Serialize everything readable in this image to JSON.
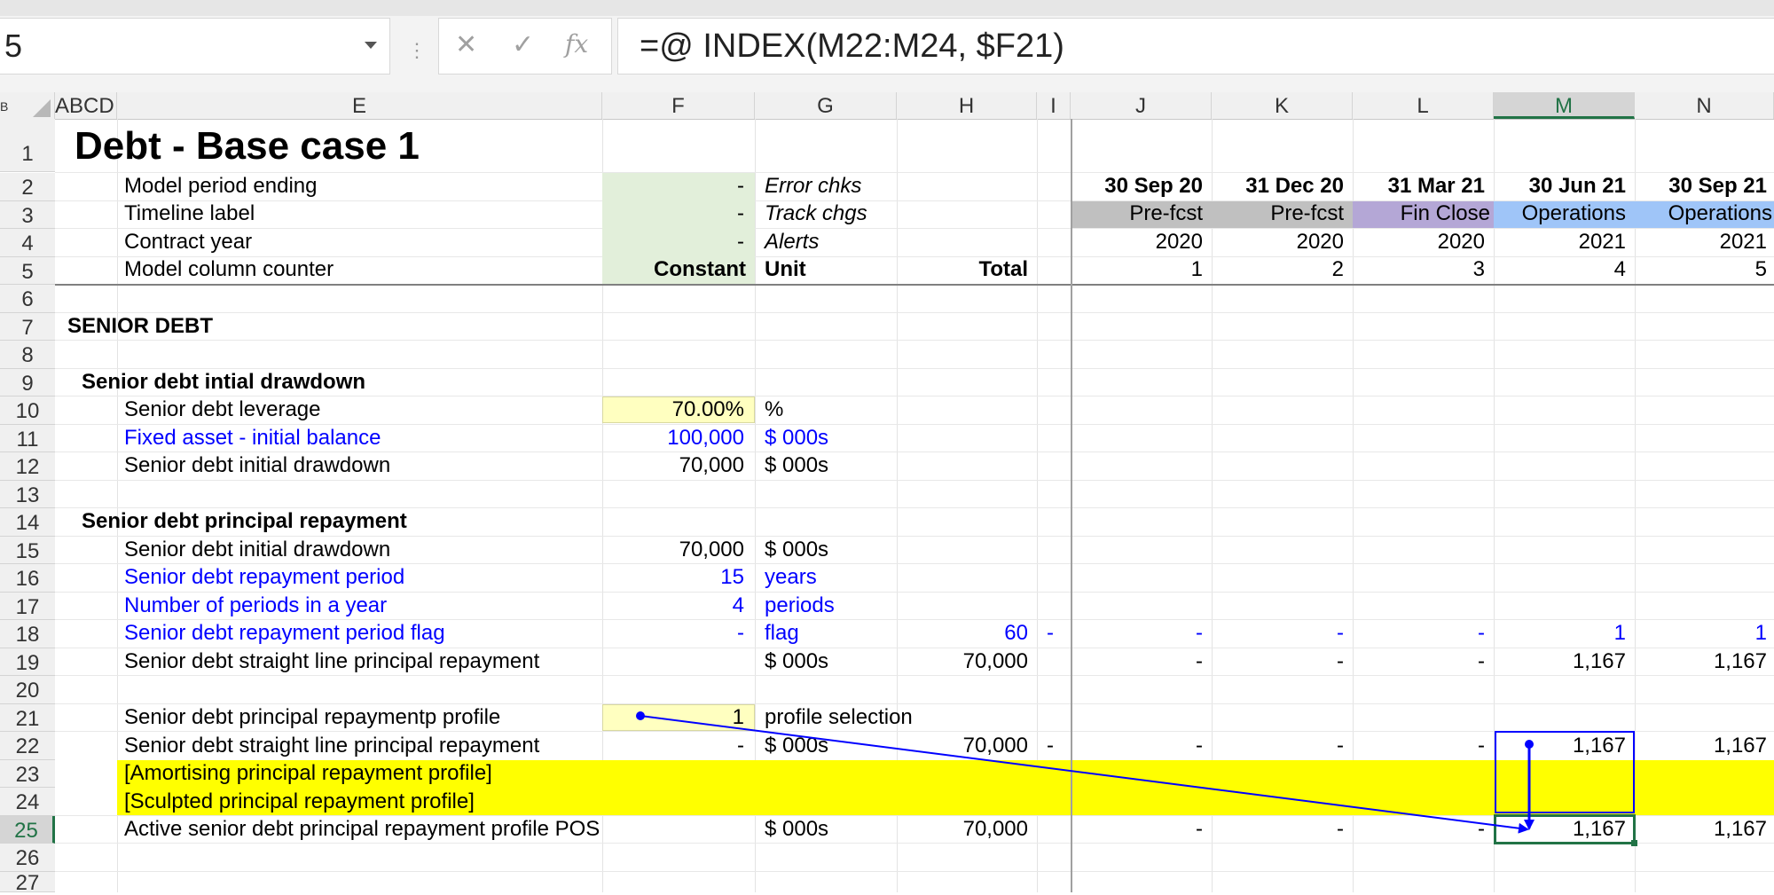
{
  "app": {
    "accent_color": "#217346"
  },
  "formula_bar": {
    "name_box": "5",
    "cancel_icon": "✕",
    "enter_icon": "✓",
    "fx_icon": "fx",
    "formula": "=@ INDEX(M22:M24, $F21)"
  },
  "columns": {
    "B": "B",
    "ABCD": "ABCD",
    "E": "E",
    "F": "F",
    "G": "G",
    "H": "H",
    "I": "I",
    "J": "J",
    "K": "K",
    "L": "L",
    "M": "M",
    "N": "N"
  },
  "rows": [
    "1",
    "2",
    "3",
    "4",
    "5",
    "6",
    "7",
    "8",
    "9",
    "10",
    "11",
    "12",
    "13",
    "14",
    "15",
    "16",
    "17",
    "18",
    "19",
    "20",
    "21",
    "22",
    "23",
    "24",
    "25",
    "26",
    "27"
  ],
  "sheet": {
    "title": "Debt - Base case 1",
    "header_labels": {
      "model_period_ending": "Model period ending",
      "timeline_label": "Timeline label",
      "contract_year": "Contract year",
      "model_column_counter": "Model column counter",
      "f2": "-",
      "f3": "-",
      "f4": "-",
      "error_chks": "Error chks",
      "track_chgs": "Track chgs",
      "alerts": "Alerts",
      "constant": "Constant",
      "unit": "Unit",
      "total": "Total"
    },
    "timeline": {
      "dates": [
        "30 Sep 20",
        "31 Dec 20",
        "31 Mar 21",
        "30 Jun 21",
        "30 Sep 21"
      ],
      "labels": [
        "Pre-fcst",
        "Pre-fcst",
        "Fin Close",
        "Operations",
        "Operations"
      ],
      "years": [
        "2020",
        "2020",
        "2020",
        "2021",
        "2021"
      ],
      "counters": [
        "1",
        "2",
        "3",
        "4",
        "5"
      ],
      "label_colors": [
        "#c0c0c0",
        "#c0c0c0",
        "#b4a7d6",
        "#9fc5f8",
        "#9fc5f8"
      ]
    },
    "section_title": "SENIOR DEBT",
    "drawdown": {
      "heading": "Senior debt intial drawdown",
      "leverage_label": "Senior debt leverage",
      "leverage_value": "70.00%",
      "leverage_unit": "%",
      "fixed_asset_label": "Fixed asset - initial balance",
      "fixed_asset_value": "100,000",
      "fixed_asset_unit": "$ 000s",
      "initial_label": "Senior debt initial drawdown",
      "initial_value": "70,000",
      "initial_unit": "$ 000s"
    },
    "repayment": {
      "heading": "Senior debt principal repayment",
      "r15_label": "Senior debt initial drawdown",
      "r15_value": "70,000",
      "r15_unit": "$ 000s",
      "r16_label": "Senior debt repayment period",
      "r16_value": "15",
      "r16_unit": "years",
      "r17_label": "Number of periods in a year",
      "r17_value": "4",
      "r17_unit": "periods",
      "r18_label": "Senior debt repayment period flag",
      "r18_value": "-",
      "r18_unit": "flag",
      "r18_total": "60",
      "r18_i": "-",
      "r18_periods": [
        "-",
        "-",
        "-",
        "1",
        "1"
      ],
      "r19_label": "Senior debt straight line principal repayment",
      "r19_unit": "$ 000s",
      "r19_total": "70,000",
      "r19_periods": [
        "-",
        "-",
        "-",
        "1,167",
        "1,167"
      ],
      "r21_label": "Senior debt principal repaymentp profile",
      "r21_value": "1",
      "r21_unit": "profile selection",
      "r22_label": "Senior debt straight line principal repayment",
      "r22_value": "-",
      "r22_unit": "$ 000s",
      "r22_total": "70,000",
      "r22_i": "-",
      "r22_periods": [
        "-",
        "-",
        "-",
        "1,167",
        "1,167"
      ],
      "r23_label": "[Amortising principal repayment profile]",
      "r24_label": "[Sculpted principal repayment profile]",
      "r25_label": "Active senior debt principal repayment profile POS",
      "r25_unit": "$ 000s",
      "r25_total": "70,000",
      "r25_periods": [
        "-",
        "-",
        "-",
        "1,167",
        "1,167"
      ]
    },
    "colors": {
      "input_yellow": "#ffffc0",
      "highlight_yellow": "#ffff00",
      "header_green": "#e2efda",
      "trace_arrow": "#0000ff",
      "blue_text": "#0000ff"
    }
  }
}
